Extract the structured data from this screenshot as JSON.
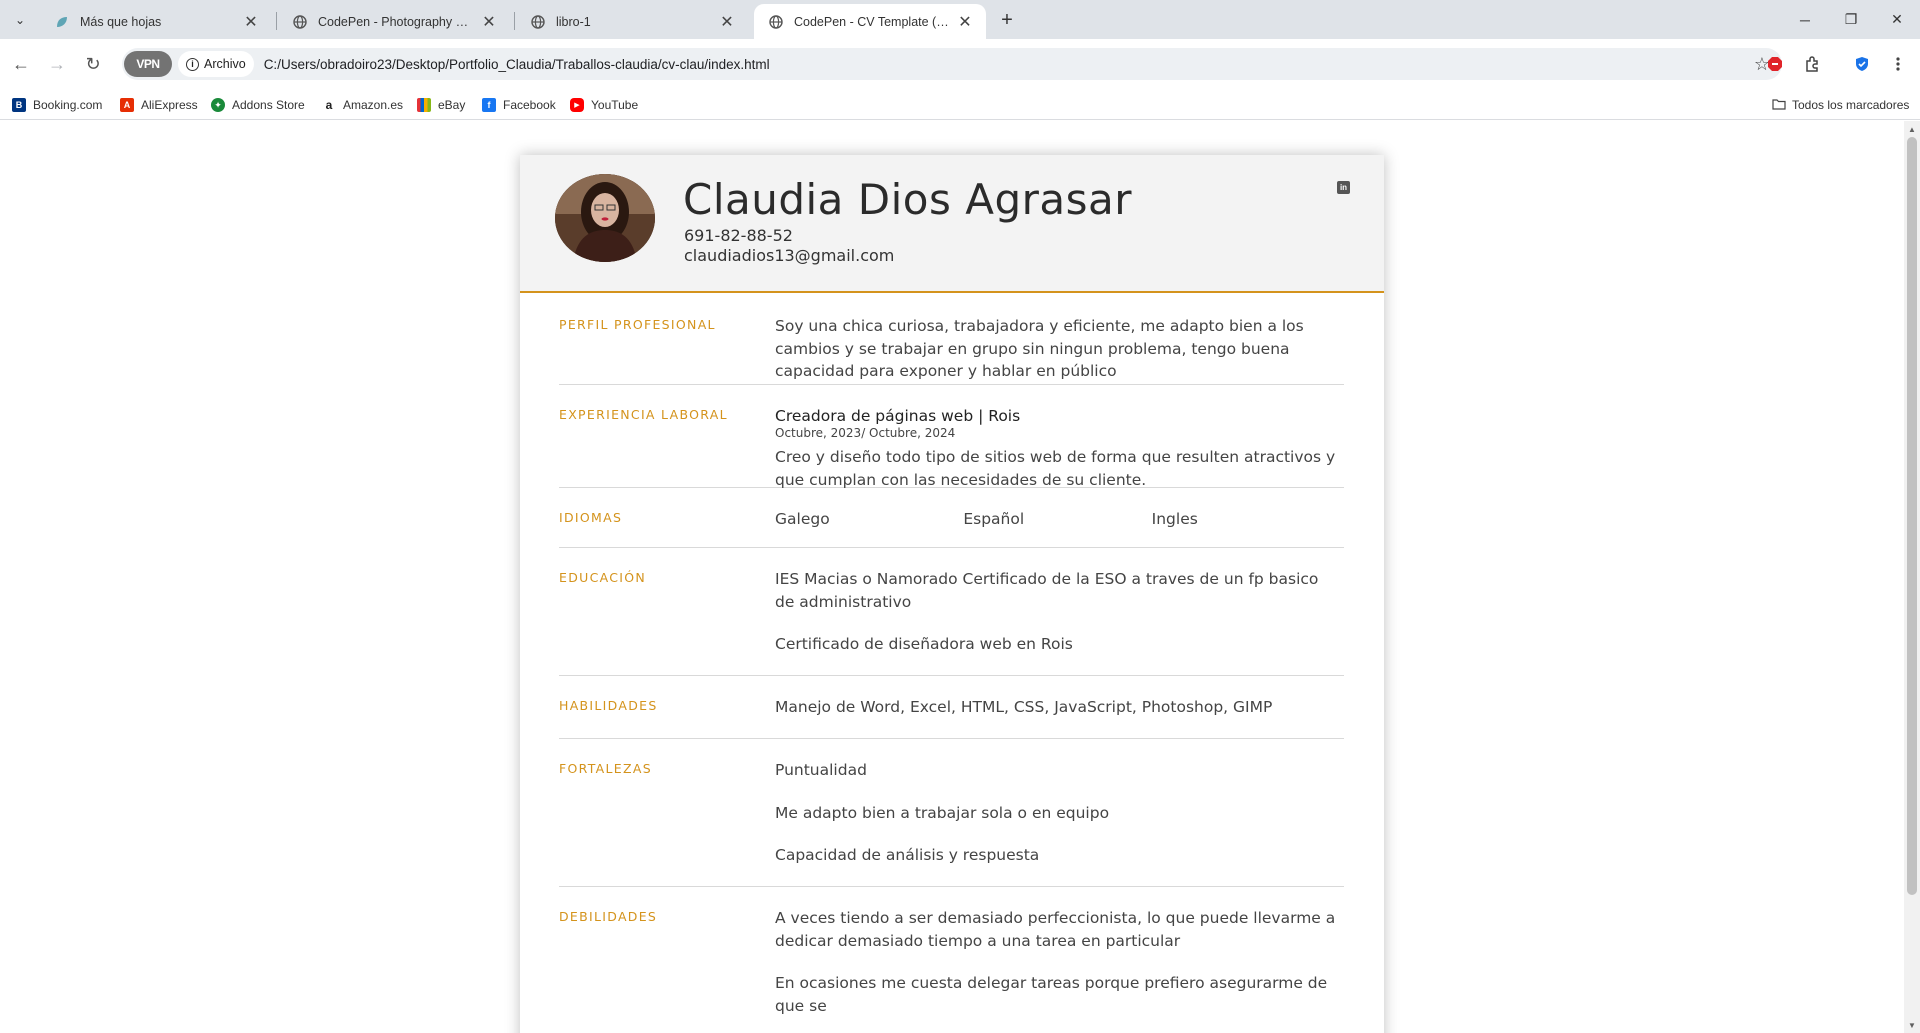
{
  "browser": {
    "tabs": [
      {
        "title": "Más que hojas",
        "active": false
      },
      {
        "title": "CodePen - Photography page c",
        "active": false
      },
      {
        "title": "libro-1",
        "active": false
      },
      {
        "title": "CodePen - CV Template (Respo",
        "active": true
      }
    ],
    "vpn_label": "VPN",
    "security_chip": "Archivo",
    "url": "C:/Users/obradoiro23/Desktop/Portfolio_Claudia/Traballos-claudia/cv-clau/index.html",
    "bookmarks": [
      {
        "label": "Booking.com",
        "icon": "booking-icon",
        "color": "#003580"
      },
      {
        "label": "AliExpress",
        "icon": "aliexpress-icon",
        "color": "#e62e04"
      },
      {
        "label": "Addons Store",
        "icon": "addons-icon",
        "color": "#1a8a3a"
      },
      {
        "label": "Amazon.es",
        "icon": "amazon-icon",
        "color": "#222222"
      },
      {
        "label": "eBay",
        "icon": "ebay-icon",
        "color": "#e53238"
      },
      {
        "label": "Facebook",
        "icon": "facebook-icon",
        "color": "#1877f2"
      },
      {
        "label": "YouTube",
        "icon": "youtube-icon",
        "color": "#ff0000"
      }
    ],
    "all_bookmarks": "Todos los marcadores"
  },
  "cv": {
    "accent_color": "#d4931c",
    "name": "Claudia Dios Agrasar",
    "phone": "691-82-88-52",
    "email": "claudiadios13@gmail.com",
    "sections": {
      "perfil": {
        "label": "PERFIL PROFESIONAL",
        "text": "Soy una chica curiosa, trabajadora y eficiente, me adapto bien a los cambios y se trabajar en grupo sin ningun problema, tengo buena capacidad para exponer y hablar en público"
      },
      "experiencia": {
        "label": "EXPERIENCIA LABORAL",
        "job_title": "Creadora de páginas web | Rois",
        "job_date": "Octubre, 2023/ Octubre, 2024",
        "job_desc": "Creo y diseño todo tipo de sitios web de forma que resulten atractivos y que cumplan con las necesidades de su cliente."
      },
      "idiomas": {
        "label": "IDIOMAS",
        "items": [
          "Galego",
          "Español",
          "Ingles"
        ]
      },
      "educacion": {
        "label": "EDUCACIÓN",
        "items": [
          "IES Macias o Namorado Certificado de la ESO a traves de un fp basico de administrativo",
          "Certificado de diseñadora web en Rois"
        ]
      },
      "habilidades": {
        "label": "HABILIDADES",
        "text": "Manejo de Word, Excel, HTML, CSS, JavaScript, Photoshop, GIMP"
      },
      "fortalezas": {
        "label": "FORTALEZAS",
        "items": [
          "Puntualidad",
          "Me adapto bien a trabajar sola o en equipo",
          "Capacidad de análisis y respuesta"
        ]
      },
      "debilidades": {
        "label": "DEBILIDADES",
        "items": [
          "A veces tiendo a ser demasiado perfeccionista, lo que puede llevarme a dedicar demasiado tiempo a una tarea en particular",
          "En ocasiones me cuesta delegar tareas porque prefiero asegurarme de que se"
        ]
      }
    }
  }
}
